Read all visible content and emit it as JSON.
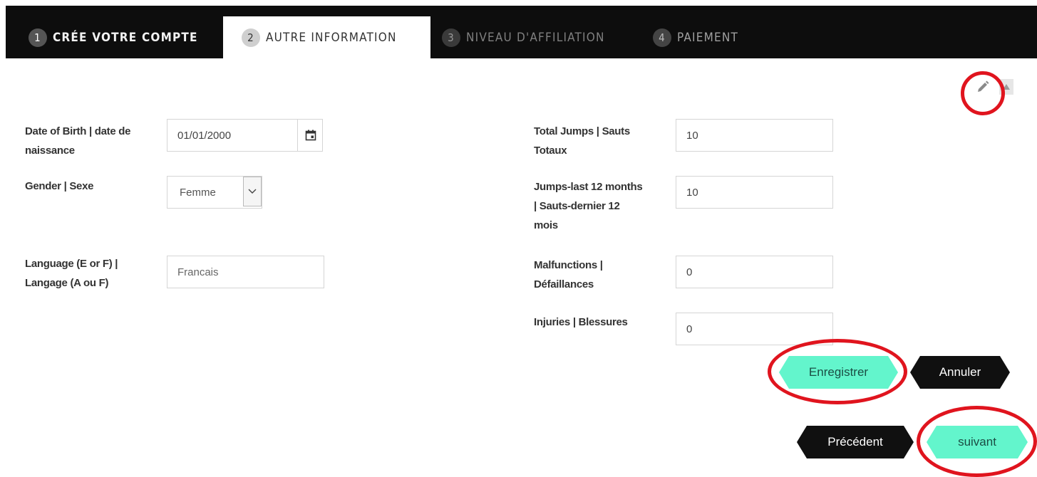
{
  "tabs": [
    {
      "num": "1",
      "label": "CRÉE VOTRE COMPTE"
    },
    {
      "num": "2",
      "label": "AUTRE INFORMATION"
    },
    {
      "num": "3",
      "label": "NIVEAU D'AFFILIATION"
    },
    {
      "num": "4",
      "label": "PAIEMENT"
    }
  ],
  "left": {
    "dob_label": [
      "Date of Birth | date de",
      "naissance"
    ],
    "dob_value": "01/01/2000",
    "gender_label": "Gender | Sexe",
    "gender_value": "Femme",
    "language_label": [
      "Language (E or F) |",
      "Langage (A ou F)"
    ],
    "language_value": "Francais"
  },
  "right": {
    "total_label": [
      "Total Jumps | Sauts",
      "Totaux"
    ],
    "total_value": "10",
    "last12_label": [
      "Jumps-last 12 months",
      "| Sauts-dernier 12",
      "mois"
    ],
    "last12_value": "10",
    "malf_label": [
      "Malfunctions |",
      "Défaillances"
    ],
    "malf_value": "0",
    "injuries_label": "Injuries | Blessures",
    "injuries_value": "0"
  },
  "buttons": {
    "save": "Enregistrer",
    "cancel": "Annuler",
    "previous": "Précédent",
    "next": "suivant"
  },
  "icons": {
    "edit": "pencil-icon",
    "calendar": "calendar-icon",
    "dropdown": "chevron-down-icon"
  },
  "colors": {
    "accent": "#63f5cc",
    "dark": "#101010",
    "annotation": "#e0141e"
  }
}
